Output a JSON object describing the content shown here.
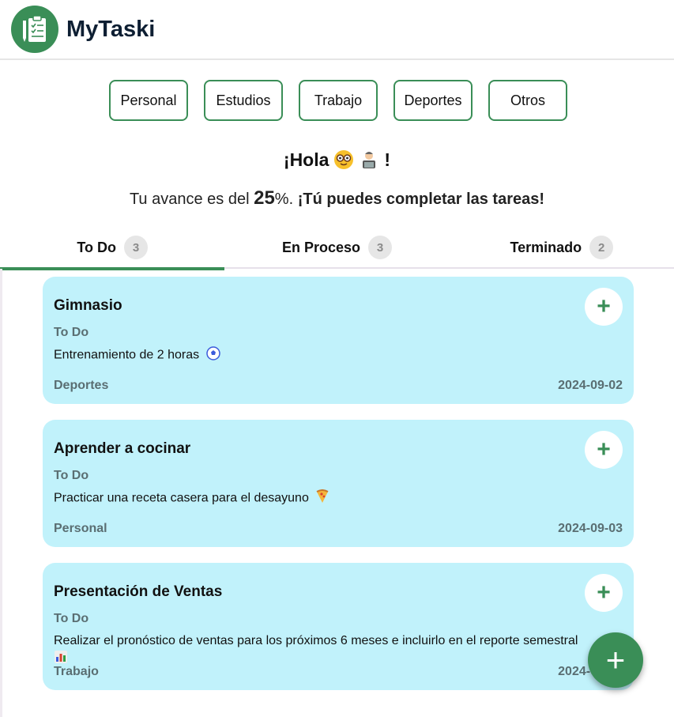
{
  "app": {
    "title": "MyTaski"
  },
  "categories": [
    "Personal",
    "Estudios",
    "Trabajo",
    "Deportes",
    "Otros"
  ],
  "greeting": {
    "text": "¡Hola",
    "suffix": "!"
  },
  "progress": {
    "prefix": "Tu avance es del",
    "value": "25",
    "unit": "%.",
    "message": "¡Tú puedes completar las tareas!"
  },
  "tabs": [
    {
      "label": "To Do",
      "count": "3",
      "active": true
    },
    {
      "label": "En Proceso",
      "count": "3",
      "active": false
    },
    {
      "label": "Terminado",
      "count": "2",
      "active": false
    }
  ],
  "tasks": [
    {
      "title": "Gimnasio",
      "status": "To Do",
      "description": "Entrenamiento de 2 horas",
      "icon": "soccer-ball-icon",
      "category": "Deportes",
      "date": "2024-09-02",
      "add_label": "+"
    },
    {
      "title": "Aprender a cocinar",
      "status": "To Do",
      "description": "Practicar una receta casera para el desayuno",
      "icon": "pizza-icon",
      "category": "Personal",
      "date": "2024-09-03",
      "add_label": "+"
    },
    {
      "title": "Presentación de Ventas",
      "status": "To Do",
      "description": "Realizar el pronóstico de ventas para los próximos 6 meses e incluirlo en el reporte semestral",
      "icon": "bar-chart-icon",
      "category": "Trabajo",
      "date": "2024-09-05",
      "add_label": "+"
    }
  ],
  "fab": {
    "label": "+"
  },
  "colors": {
    "accent": "#3a8e57",
    "card": "#c1f2fb",
    "muted": "#5a6e72"
  }
}
